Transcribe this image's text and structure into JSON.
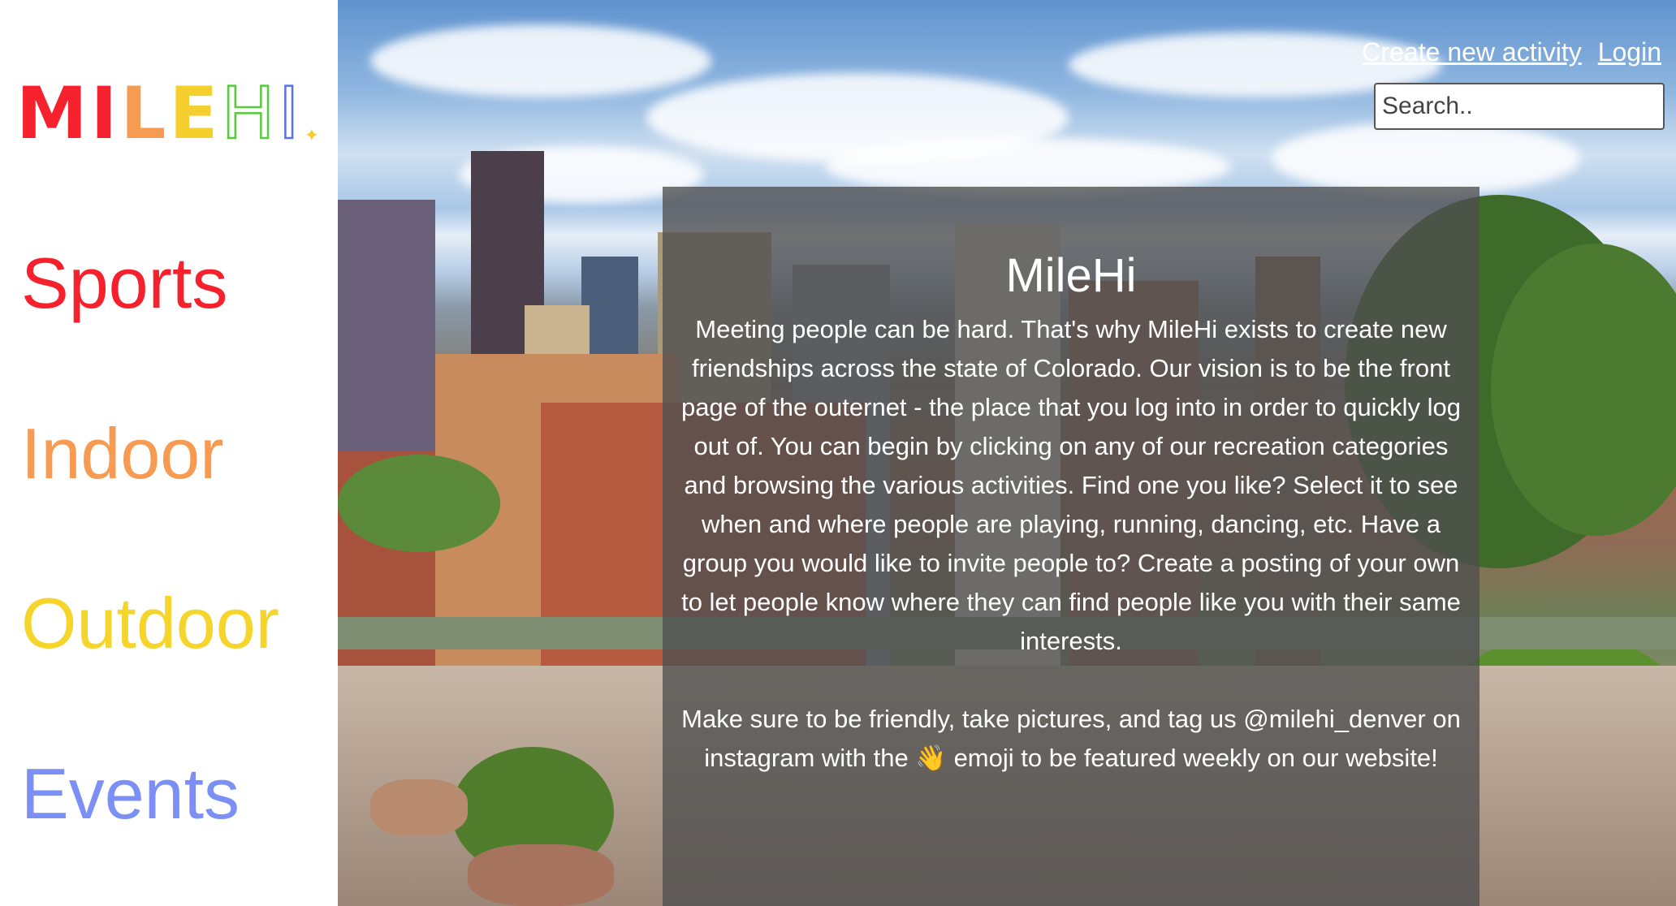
{
  "sidebar": {
    "logo": {
      "letters": [
        {
          "char": "M",
          "color": "#f5222d"
        },
        {
          "char": "I",
          "color": "#f5222d"
        },
        {
          "char": "L",
          "color": "#f79b52"
        },
        {
          "char": "E",
          "color": "#f5cf2e"
        },
        {
          "char": "H",
          "color": "#59c93d"
        },
        {
          "char": "I",
          "color": "#5b73e8"
        }
      ],
      "text": "MILEHI"
    },
    "categories": [
      {
        "label": "Sports",
        "color": "#f5222d"
      },
      {
        "label": "Indoor",
        "color": "#f79b52"
      },
      {
        "label": "Outdoor",
        "color": "#f5d52b"
      },
      {
        "label": "Events",
        "color": "#7b8ff5"
      }
    ]
  },
  "header": {
    "create_link": "Create new activity",
    "login_link": "Login",
    "search_placeholder": "Search.."
  },
  "panel": {
    "title": "MileHi",
    "paragraph1": "Meeting people can be hard. That's why MileHi exists to create new friendships across the state of Colorado. Our vision is to be the front page of the outernet - the place that you log into in order to quickly log out of. You can begin by clicking on any of our recreation categories and browsing the various activities. Find one you like? Select it to see when and where people are playing, running, dancing, etc. Have a group you would like to invite people to? Create a posting of your own to let people know where they can find people like you with their same interests.",
    "paragraph2": "Make sure to be friendly, take pictures, and tag us @milehi_denver on instagram with the 👋 emoji to be featured weekly on our website!"
  }
}
